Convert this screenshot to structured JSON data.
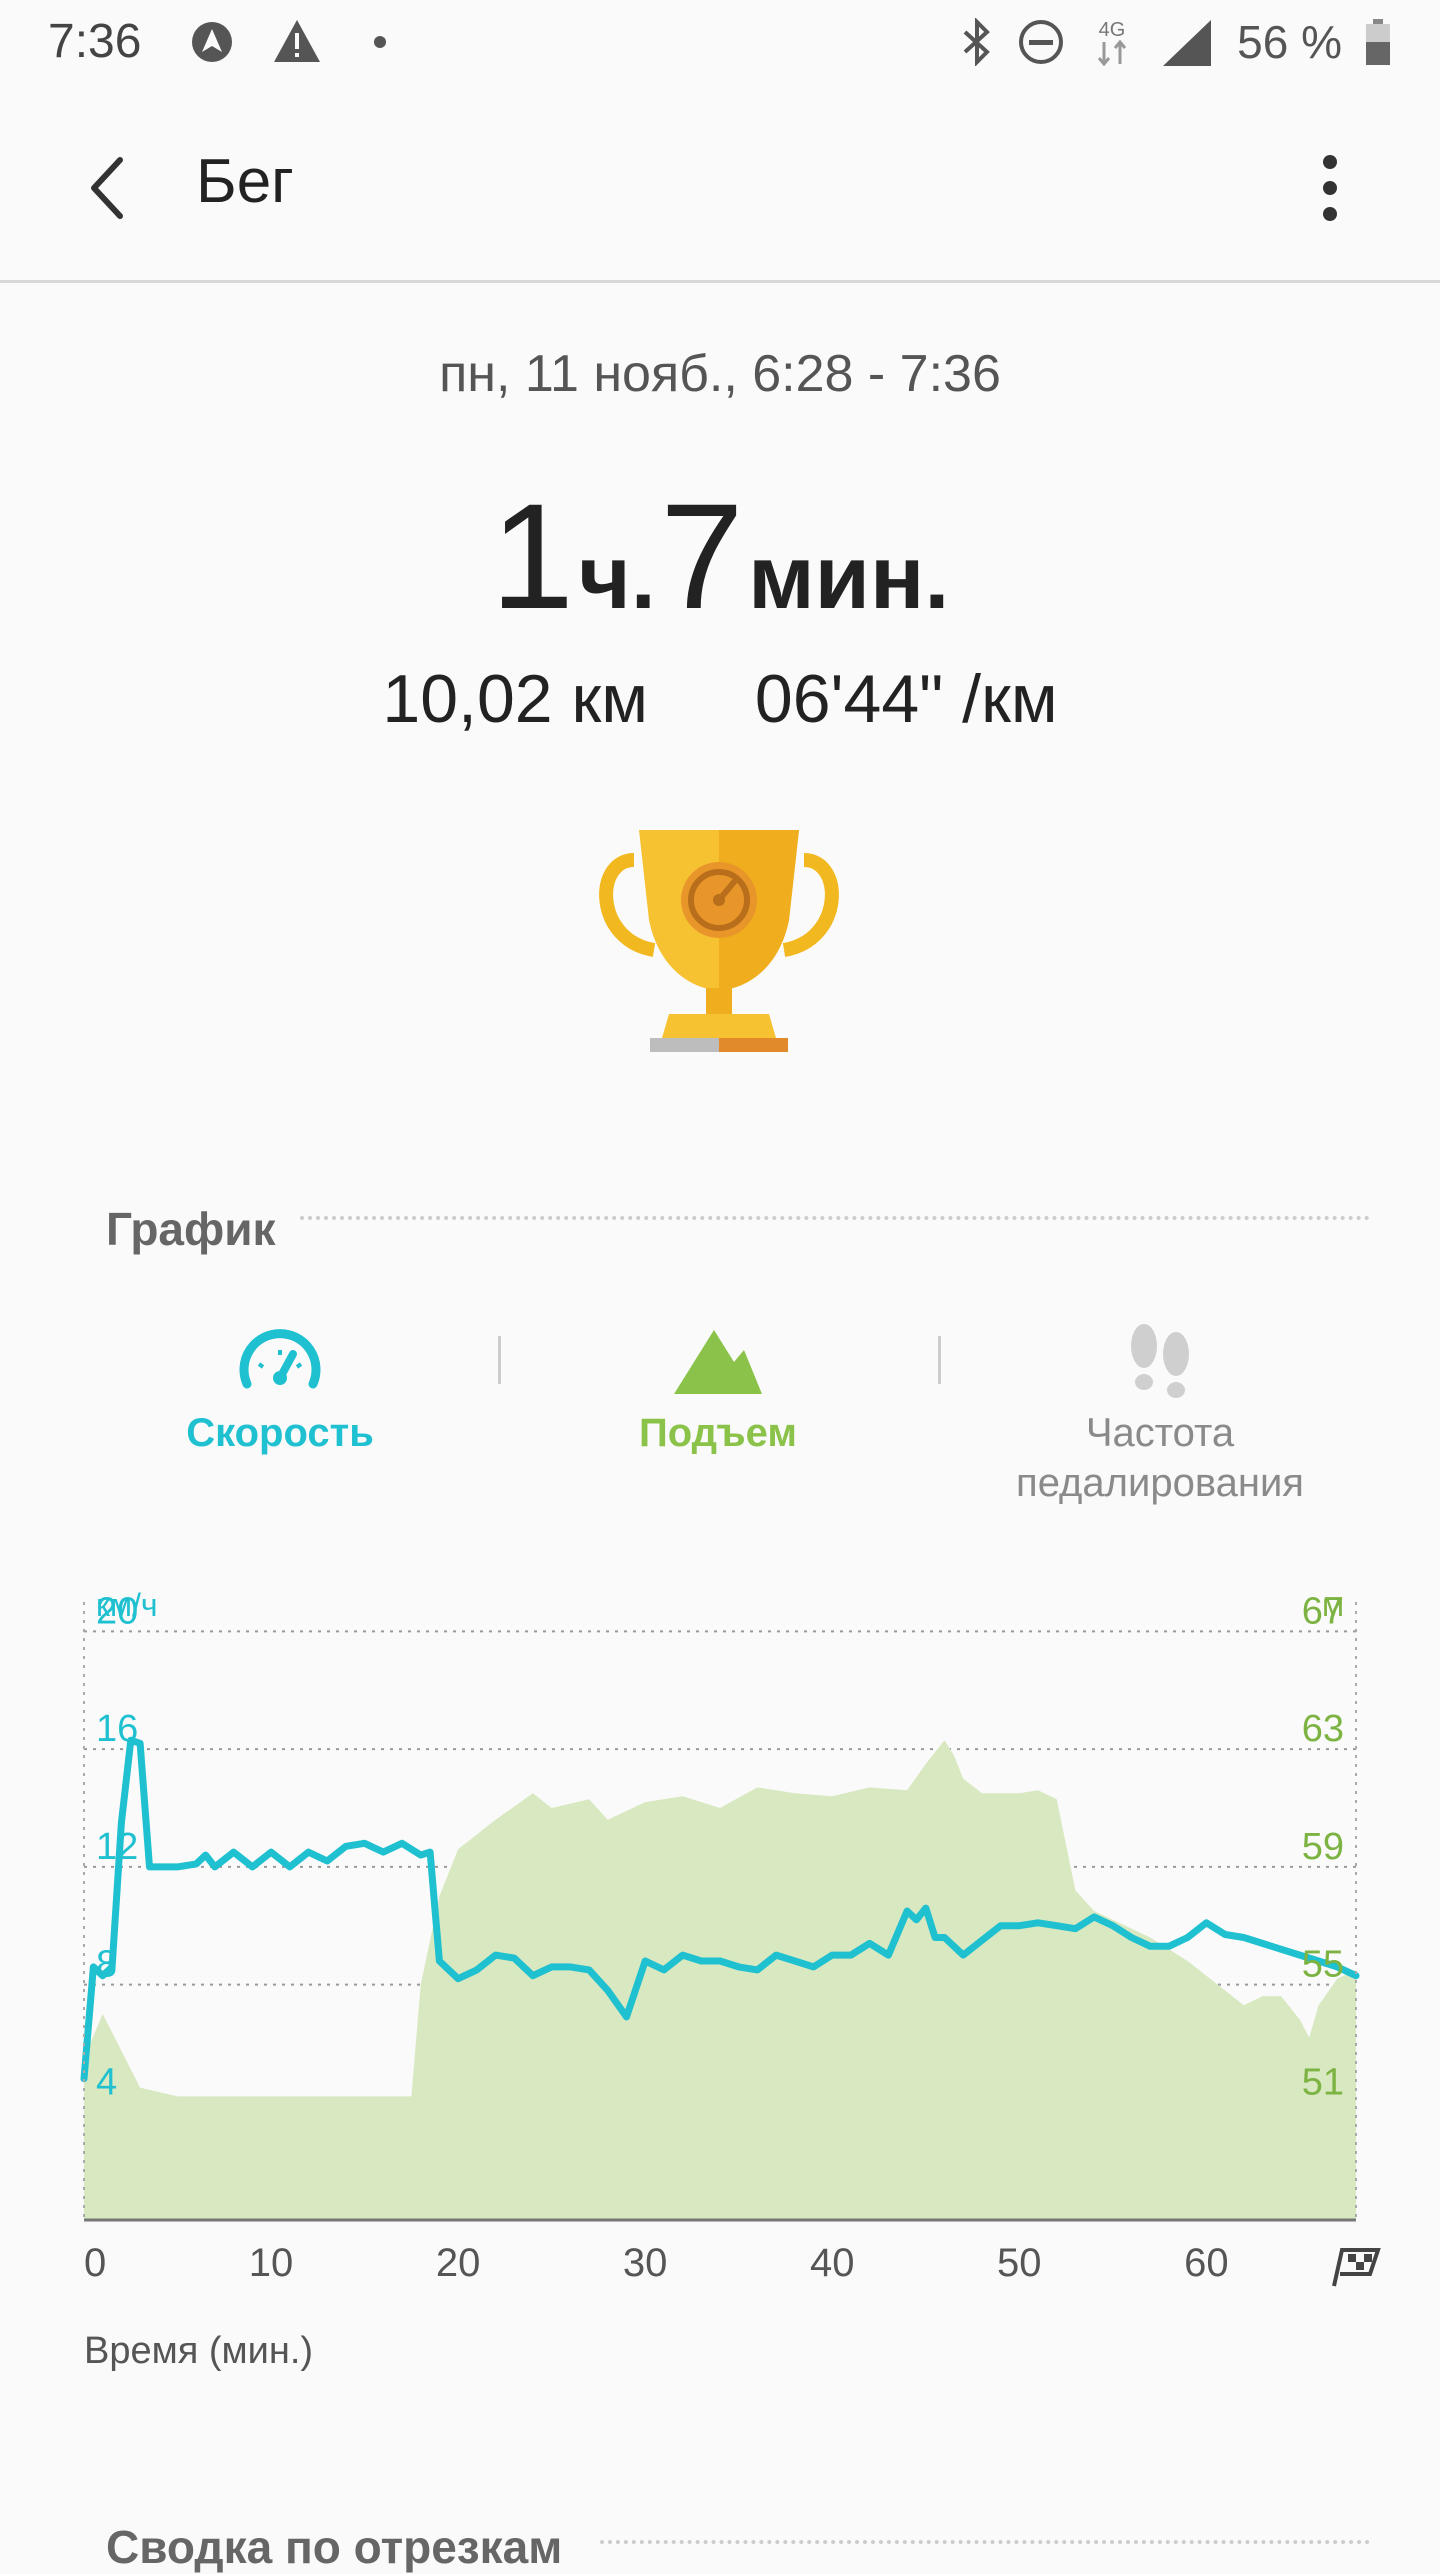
{
  "status_bar": {
    "time": "7:36",
    "battery_percent": "56 %",
    "network": "4G",
    "icons": [
      "navigation-icon",
      "warning-icon",
      "dot-icon",
      "bluetooth-icon",
      "dnd-icon",
      "network-4g-icon",
      "signal-icon",
      "battery-icon"
    ]
  },
  "app_bar": {
    "title": "Бег",
    "back_icon": "back-arrow-icon",
    "more_icon": "more-vert-icon"
  },
  "summary": {
    "date_range": "пн, 11 нояб., 6:28 - 7:36",
    "duration_hours": "1",
    "duration_hours_unit": "ч.",
    "duration_minutes": "7",
    "duration_minutes_unit": "мин.",
    "distance": "10,02 км",
    "pace": "06'44\" /км",
    "trophy_icon": "trophy-icon"
  },
  "graph_section": {
    "title": "График",
    "tabs": [
      {
        "label": "Скорость",
        "icon": "speedometer-icon",
        "color": "#1fc0d0",
        "active": true
      },
      {
        "label": "Подъем",
        "icon": "mountain-icon",
        "color": "#8bc34a",
        "active": true
      },
      {
        "label_line1": "Частота",
        "label_line2": "педалирования",
        "icon": "footsteps-icon",
        "color": "#9e9e9e",
        "active": false
      }
    ],
    "x_axis_title": "Время (мин.)"
  },
  "next_section": {
    "title": "Сводка по отрезкам"
  },
  "colors": {
    "speed": "#1fc0d0",
    "elevation_line": "#7cb342",
    "elevation_fill": "#d8e8c0",
    "accent_green": "#8bc34a"
  },
  "chart_data": {
    "type": "line",
    "title": "",
    "xlabel": "Время (мин.)",
    "x_ticks": [
      "0",
      "10",
      "20",
      "30",
      "40",
      "50",
      "60"
    ],
    "x_range": [
      0,
      68
    ],
    "finish_icon": "finish-flag-icon",
    "y_left": {
      "unit": "км/ч",
      "ticks": [
        "20",
        "16",
        "12",
        "8",
        "4"
      ],
      "range": [
        0,
        21
      ]
    },
    "y_right": {
      "unit": "м",
      "ticks": [
        "67",
        "63",
        "59",
        "55",
        "51"
      ],
      "range": [
        47,
        68
      ]
    },
    "grid": true,
    "series": [
      {
        "name": "Скорость",
        "axis": "left",
        "style": "line",
        "x": [
          0,
          0.5,
          1,
          1.5,
          2,
          2.5,
          3,
          3.5,
          4,
          5,
          6,
          6.5,
          7,
          8,
          9,
          10,
          11,
          12,
          13,
          14,
          15,
          16,
          17,
          18,
          18.5,
          19,
          20,
          21,
          22,
          23,
          24,
          25,
          26,
          27,
          28,
          29,
          30,
          31,
          32,
          33,
          34,
          35,
          36,
          37,
          38,
          39,
          40,
          41,
          42,
          43,
          44,
          44.5,
          45,
          45.5,
          46,
          47,
          48,
          49,
          50,
          51,
          52,
          53,
          54,
          55,
          56,
          57,
          58,
          59,
          60,
          61,
          62,
          63,
          64,
          65,
          66,
          67,
          68
        ],
        "values": [
          4.8,
          8.6,
          8.3,
          8.6,
          13.5,
          16.3,
          16.2,
          12.0,
          12.0,
          12.0,
          12.1,
          12.4,
          12.0,
          12.5,
          12.0,
          12.5,
          12.0,
          12.5,
          12.2,
          12.7,
          12.8,
          12.5,
          12.8,
          12.4,
          12.5,
          8.8,
          8.2,
          8.5,
          9.0,
          8.9,
          8.3,
          8.6,
          8.6,
          8.5,
          7.8,
          6.9,
          8.8,
          8.5,
          9.0,
          8.8,
          8.8,
          8.6,
          8.5,
          9.0,
          8.8,
          8.6,
          9.0,
          9.0,
          9.4,
          9.0,
          10.5,
          10.2,
          10.6,
          9.6,
          9.6,
          9.0,
          9.5,
          10.0,
          10.0,
          10.1,
          10.0,
          9.9,
          10.3,
          10.0,
          9.6,
          9.3,
          9.3,
          9.6,
          10.1,
          9.7,
          9.6,
          9.4,
          9.2,
          9.0,
          8.8,
          8.6,
          8.3
        ]
      },
      {
        "name": "Подъем",
        "axis": "right",
        "style": "area",
        "x": [
          0,
          1,
          3,
          5,
          10,
          15,
          17.5,
          18,
          19,
          20,
          22,
          24,
          25,
          27,
          28,
          30,
          32,
          34,
          36,
          38,
          40,
          42,
          44,
          45,
          46,
          46.5,
          47,
          48,
          49,
          50,
          51,
          52,
          53,
          54,
          55,
          57,
          59,
          61,
          62,
          63,
          64,
          65,
          65.5,
          66,
          67,
          68
        ],
        "values": [
          52.5,
          54.0,
          51.5,
          51.2,
          51.2,
          51.2,
          51.2,
          55.0,
          58.0,
          59.6,
          60.6,
          61.5,
          61.0,
          61.3,
          60.6,
          61.2,
          61.4,
          61.0,
          61.7,
          61.5,
          61.4,
          61.7,
          61.6,
          62.5,
          63.3,
          62.8,
          62.0,
          61.5,
          61.5,
          61.5,
          61.6,
          61.3,
          58.2,
          57.5,
          57.2,
          56.6,
          55.8,
          54.8,
          54.3,
          54.6,
          54.6,
          53.8,
          53.2,
          54.3,
          55.2,
          55.5
        ]
      }
    ]
  }
}
